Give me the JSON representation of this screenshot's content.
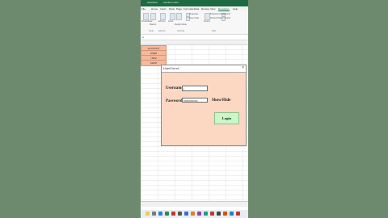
{
  "excel": {
    "title_left": "AutoSave",
    "title_mid": "userform.xlsm",
    "tabs": [
      "File",
      "Home",
      "Insert",
      "Draw",
      "Page",
      "Formulas",
      "Data",
      "Review",
      "View",
      "Developer",
      "Help"
    ],
    "active_tab": "Developer",
    "ribbon_labels": [
      "Visual Basic",
      "Macros",
      "Add-ins",
      "Insert",
      "Design Mode",
      "Properties",
      "View Code",
      "Source",
      "Expansion Packs",
      "Refresh Data",
      "Import",
      "Export"
    ],
    "ribbon_groups": [
      "Code",
      "Add-ins",
      "Controls",
      "XML"
    ],
    "name_box": "A",
    "sheet_cells": [
      "ACCOUNT",
      "USER",
      "ITEM",
      "SHOP"
    ]
  },
  "userform": {
    "title": "UserForm1",
    "close_glyph": "×",
    "username_label": "Username",
    "username_value": "|",
    "password_label": "Password",
    "password_value": "xxxxxxxxxx",
    "showhide_label": "Show/Hide",
    "login_label": "Login"
  },
  "colors": {
    "form_bg": "#fcd7c1",
    "login_bg": "#c9f7c8",
    "excel_green": "#1e6b43",
    "cell_fill": "#f5b99c",
    "background": "#6d8a6f"
  }
}
